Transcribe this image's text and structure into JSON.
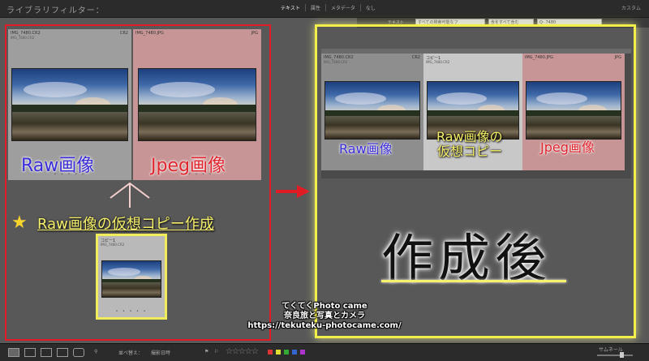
{
  "topbar": {
    "title": "ライブラリフィルター：",
    "tabs": [
      "テキスト",
      "属性",
      "メタデータ",
      "なし"
    ],
    "custom": "カスタム"
  },
  "subbar": {
    "label": "テキスト",
    "field1": "すべての検索可能なフ",
    "field2": "含をすべて含む",
    "search": "Q- 7480"
  },
  "left": {
    "cell_raw": {
      "name": "IMG_7480.CR2",
      "sub": "IMG_7480.CR2",
      "ext": "CR2",
      "dots": "• • • • •"
    },
    "cell_jpg": {
      "name": "IMG_7480.JPG",
      "ext": "JPG",
      "dots": "• • • • •"
    },
    "label_raw": "Raw画像",
    "label_jpg": "Jpeg画像",
    "selected_cell": {
      "name": "コピー1",
      "sub": "IMG_7480.CR2",
      "dots": "• • • • •"
    }
  },
  "caption": {
    "star": "★",
    "text": "Raw画像の仮想コピー作成"
  },
  "right": {
    "cell_raw": {
      "name": "IMG_7480.CR2",
      "sub": "IMG_7480.CR2",
      "ext": "CR2"
    },
    "cell_copy": {
      "name": "コピー1",
      "sub": "IMG_7480.CR2"
    },
    "cell_jpg": {
      "name": "IMG_7480.JPG",
      "ext": "JPG"
    },
    "label_raw": "Raw画像",
    "label_copy_line1": "Raw画像の",
    "label_copy_line2": "仮想コピー",
    "label_jpg": "Jpeg画像",
    "big": "作成後"
  },
  "watermark": {
    "line1": "てくてくPhoto came",
    "line2": "奈良旅と写真とカメラ",
    "line3": "https://tekuteku-photocame.com/"
  },
  "bottombar": {
    "sort_label": "並べ替え：",
    "sort_value": "撮影日時",
    "stars": "☆☆☆☆☆",
    "thumb_label": "サムネール",
    "colors": [
      "#d33",
      "#dd3",
      "#3a3",
      "#36c",
      "#a3c"
    ]
  }
}
